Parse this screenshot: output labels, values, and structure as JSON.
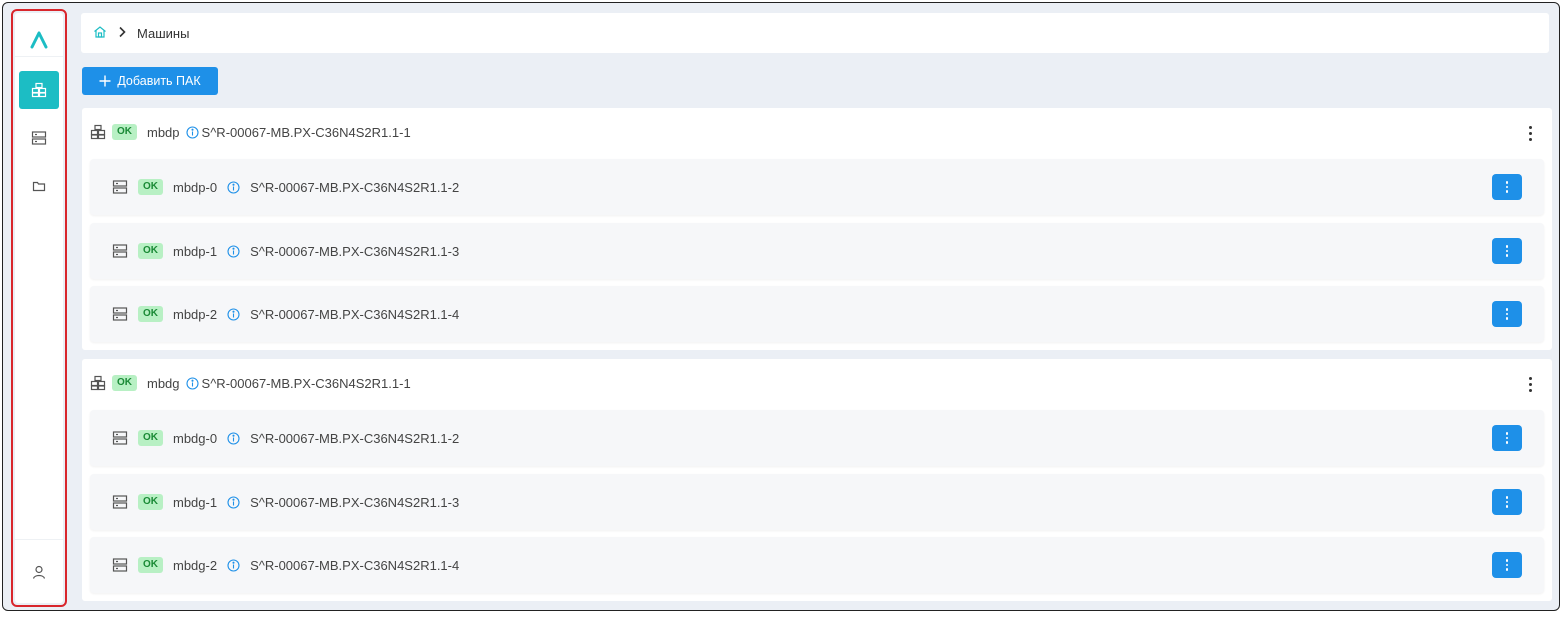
{
  "breadcrumb": {
    "current": "Машины"
  },
  "toolbar": {
    "add_label": "Добавить ПАК"
  },
  "colors": {
    "accent": "#1cbdc4",
    "primary": "#1e90e8",
    "badge_bg": "#b8f0c4",
    "badge_text": "#1a8a36",
    "highlight": "#d9262c"
  },
  "sidebar": {
    "logo": "Λ",
    "items": [
      {
        "icon": "cluster-icon",
        "active": true
      },
      {
        "icon": "server-icon",
        "active": false
      },
      {
        "icon": "folder-icon",
        "active": false
      }
    ],
    "bottom_icon": "user-icon"
  },
  "groups": [
    {
      "status": "OK",
      "name": "mbdp",
      "serial": "S^R-00067-MB.PX-C36N4S2R1.1-1",
      "machines": [
        {
          "status": "OK",
          "name": "mbdp-0",
          "serial": "S^R-00067-MB.PX-C36N4S2R1.1-2"
        },
        {
          "status": "OK",
          "name": "mbdp-1",
          "serial": "S^R-00067-MB.PX-C36N4S2R1.1-3"
        },
        {
          "status": "OK",
          "name": "mbdp-2",
          "serial": "S^R-00067-MB.PX-C36N4S2R1.1-4"
        }
      ]
    },
    {
      "status": "OK",
      "name": "mbdg",
      "serial": "S^R-00067-MB.PX-C36N4S2R1.1-1",
      "machines": [
        {
          "status": "OK",
          "name": "mbdg-0",
          "serial": "S^R-00067-MB.PX-C36N4S2R1.1-2"
        },
        {
          "status": "OK",
          "name": "mbdg-1",
          "serial": "S^R-00067-MB.PX-C36N4S2R1.1-3"
        },
        {
          "status": "OK",
          "name": "mbdg-2",
          "serial": "S^R-00067-MB.PX-C36N4S2R1.1-4"
        }
      ]
    }
  ]
}
